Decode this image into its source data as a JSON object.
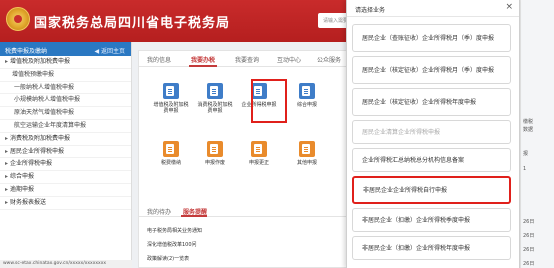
{
  "header": {
    "title": "国家税务总局四川省电子税务局",
    "search_placeholder": "请输入需要搜索的内容"
  },
  "sidebar": {
    "title": "税费申报及缴纳",
    "back_label": "◀ 返回主页",
    "items": [
      {
        "label": "增值税及附加税费申报",
        "type": "group"
      },
      {
        "label": "增值税预缴申报",
        "type": "sub"
      },
      {
        "label": "一般纳税人增值税申报",
        "type": "sub2"
      },
      {
        "label": "小规模纳税人增值税申报",
        "type": "sub2"
      },
      {
        "label": "原油天然气增值税申报",
        "type": "sub2"
      },
      {
        "label": "航空运输企业年度清算申报",
        "type": "sub2"
      },
      {
        "label": "消费税及附加税费申报",
        "type": "group"
      },
      {
        "label": "居民企业所得税申报",
        "type": "group"
      },
      {
        "label": "企业所得税申报",
        "type": "group"
      },
      {
        "label": "综合申报",
        "type": "group"
      },
      {
        "label": "逾期申报",
        "type": "group"
      },
      {
        "label": "财务报表报送",
        "type": "group"
      }
    ]
  },
  "main": {
    "tabs": [
      "我的信息",
      "我要办税",
      "我要查询",
      "互动中心",
      "公众服务"
    ],
    "active_tab": "我要办税",
    "icons": [
      {
        "label": "增值税及附加税费申报"
      },
      {
        "label": "消费税及附加税费申报"
      },
      {
        "label": "企业所得税申报"
      },
      {
        "label": "综合申报"
      },
      {
        "label": "税费缴纳"
      },
      {
        "label": "申报作废"
      },
      {
        "label": "申报更正"
      },
      {
        "label": "其他申报"
      }
    ],
    "tabs2": [
      "我的待办",
      "服务提醒"
    ],
    "notices": [
      "电子税务局相关业务通知",
      "深化增值税改革100问",
      "政策解读(2)一览表"
    ]
  },
  "dialog": {
    "title": "请选择业务",
    "close": "×",
    "options": [
      {
        "label": "居民企业（查账征收）企业所得税月（季）度申报",
        "state": "normal"
      },
      {
        "label": "居民企业（核定征收）企业所得税月（季）度申报",
        "state": "normal"
      },
      {
        "label": "居民企业（核定征收）企业所得税年度申报",
        "state": "normal"
      },
      {
        "label": "居民企业清算企业所得税申报",
        "state": "disabled"
      },
      {
        "label": "企业所得税汇总纳税总分机构信息备案",
        "state": "normal"
      },
      {
        "label": "非居民企业企业所得税自行申报",
        "state": "selected"
      },
      {
        "label": "非居民企业（扣缴）企业所得税季度申报",
        "state": "normal"
      },
      {
        "label": "非居民企业（扣缴）企业所得税年度申报",
        "state": "normal"
      }
    ]
  },
  "right_panel": {
    "labels": [
      "缴税",
      "数据",
      "报",
      "1",
      "26日",
      "26日",
      "26日",
      "26日"
    ]
  },
  "statusbar": "www.sc-etax.chinatax.gov.cn/xxxxx/xxxxxxxx"
}
